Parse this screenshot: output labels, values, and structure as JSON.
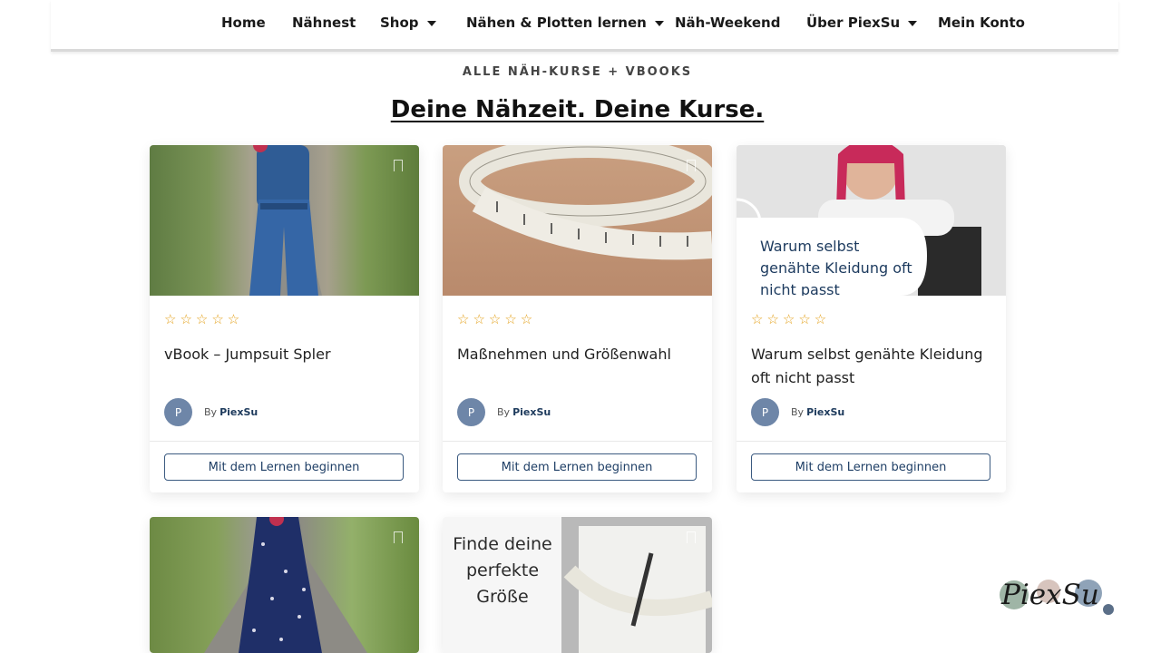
{
  "nav": {
    "items": [
      {
        "label": "Home",
        "dropdown": false
      },
      {
        "label": "Nähnest",
        "dropdown": false
      },
      {
        "label": "Shop",
        "dropdown": true
      },
      {
        "label": "Nähen & Plotten lernen",
        "dropdown": true
      },
      {
        "label": "Näh-Weekend",
        "dropdown": false
      },
      {
        "label": "Über PiexSu",
        "dropdown": true
      },
      {
        "label": "Mein Konto",
        "dropdown": false
      }
    ]
  },
  "header": {
    "subtitle": "ALLE NÄH-KURSE + VBOOKS",
    "title": "Deine Nähzeit. Deine Kurse."
  },
  "courses": [
    {
      "title": "vBook – Jumpsuit Spler",
      "rating_stars": "☆☆☆☆☆",
      "avatar_initial": "P",
      "by": "By",
      "author": "PiexSu",
      "cta": "Mit dem Lernen beginnen",
      "thumb": "jumpsuit-photo"
    },
    {
      "title": "Maßnehmen und Größenwahl",
      "rating_stars": "☆☆☆☆☆",
      "avatar_initial": "P",
      "by": "By",
      "author": "PiexSu",
      "cta": "Mit dem Lernen beginnen",
      "thumb": "measuring-tape-photo"
    },
    {
      "title": "Warum selbst genähte Kleidung oft nicht passt",
      "rating_stars": "☆☆☆☆☆",
      "avatar_initial": "P",
      "by": "By",
      "author": "PiexSu",
      "cta": "Mit dem Lernen beginnen",
      "thumb": "instructor-photo",
      "thumb_text": "Warum selbst genähte Kleidung oft nicht passt"
    },
    {
      "thumb": "dress-photo"
    },
    {
      "thumb": "size-guide-photo",
      "thumb_text": "Finde deine perfekte Größe"
    }
  ],
  "logo": {
    "text": "PiexSu"
  },
  "colors": {
    "accent": "#3b5a80",
    "star": "#e4a11b",
    "avatar": "#6e86a8",
    "author": "#1d3a5c"
  }
}
